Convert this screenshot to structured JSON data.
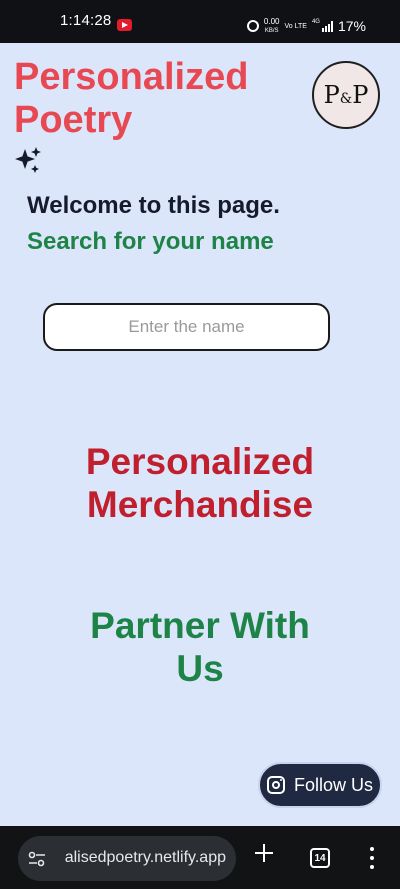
{
  "status_bar": {
    "time": "1:14:28",
    "net_speed": "0.00",
    "net_unit": "KB/S",
    "volte": "Vo LTE",
    "network": "4G",
    "battery": "17%"
  },
  "header": {
    "title_line1": "Personalized",
    "title_line2": "Poetry",
    "logo_text_left": "P",
    "logo_text_amp": "&",
    "logo_text_right": "P"
  },
  "intro": {
    "welcome": "Welcome to this page.",
    "search_prompt": "Search for your name"
  },
  "search": {
    "placeholder": "Enter the name",
    "value": ""
  },
  "links": {
    "merch_line1": "Personalized",
    "merch_line2": "Merchandise",
    "partner_line1": "Partner With",
    "partner_line2": "Us"
  },
  "follow": {
    "label": "Follow Us"
  },
  "browser": {
    "url": "alisedpoetry.netlify.app",
    "tab_count": "14"
  },
  "icons": {
    "sparkle": "sparkle-icon",
    "instagram": "instagram-icon",
    "tune": "tune-icon",
    "plus": "plus-icon",
    "tabs": "tabs-icon",
    "menu": "more-vert-icon"
  },
  "colors": {
    "background": "#dbe6fb",
    "title_red": "#e84852",
    "merch_red": "#c01f2d",
    "green": "#1e8346",
    "navy": "#1f2942"
  }
}
